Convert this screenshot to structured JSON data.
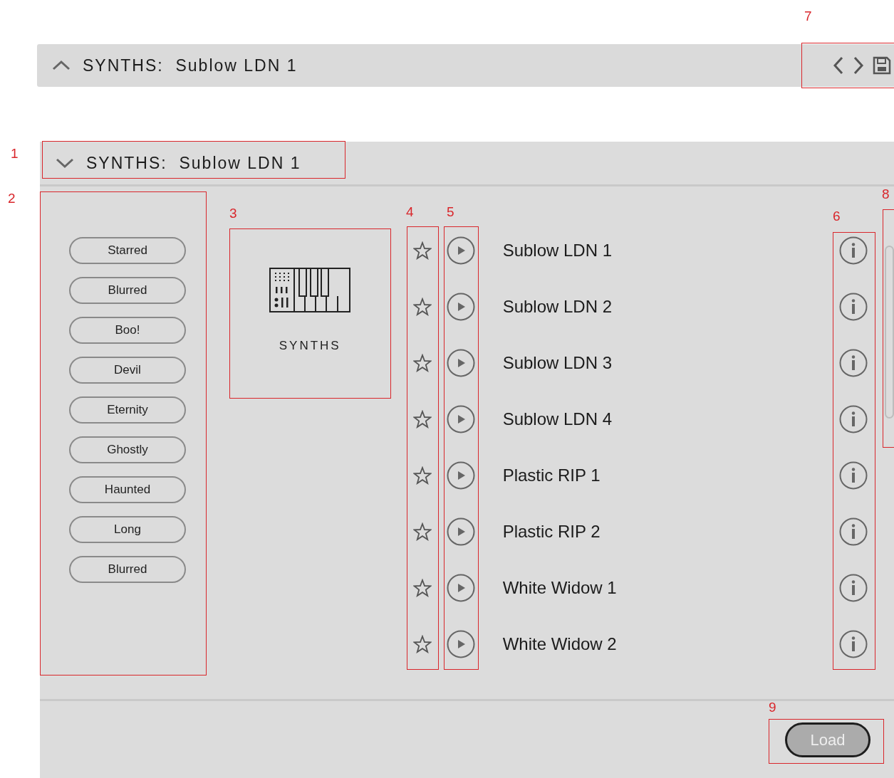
{
  "top_bar": {
    "title": "SYNTHS:  Sublow LDN 1",
    "expanded": false
  },
  "panel": {
    "title": "SYNTHS:  Sublow LDN 1",
    "expanded": true
  },
  "tags": [
    {
      "label": "Starred"
    },
    {
      "label": "Blurred"
    },
    {
      "label": "Boo!"
    },
    {
      "label": "Devil"
    },
    {
      "label": "Eternity"
    },
    {
      "label": "Ghostly"
    },
    {
      "label": "Haunted"
    },
    {
      "label": "Long"
    },
    {
      "label": "Blurred"
    }
  ],
  "category": {
    "label": "SYNTHS"
  },
  "presets": [
    {
      "name": "Sublow LDN 1",
      "starred": false
    },
    {
      "name": "Sublow LDN 2",
      "starred": false
    },
    {
      "name": "Sublow LDN 3",
      "starred": false
    },
    {
      "name": "Sublow LDN 4",
      "starred": false
    },
    {
      "name": "Plastic RIP 1",
      "starred": false
    },
    {
      "name": "Plastic RIP 2",
      "starred": false
    },
    {
      "name": "White Widow 1",
      "starred": false
    },
    {
      "name": "White Widow 2",
      "starred": false
    }
  ],
  "load_button": {
    "label": "Load",
    "disabled": true
  },
  "annotations": [
    {
      "label": "1"
    },
    {
      "label": "2"
    },
    {
      "label": "3"
    },
    {
      "label": "4"
    },
    {
      "label": "5"
    },
    {
      "label": "6"
    },
    {
      "label": "7"
    },
    {
      "label": "8"
    },
    {
      "label": "9"
    }
  ]
}
